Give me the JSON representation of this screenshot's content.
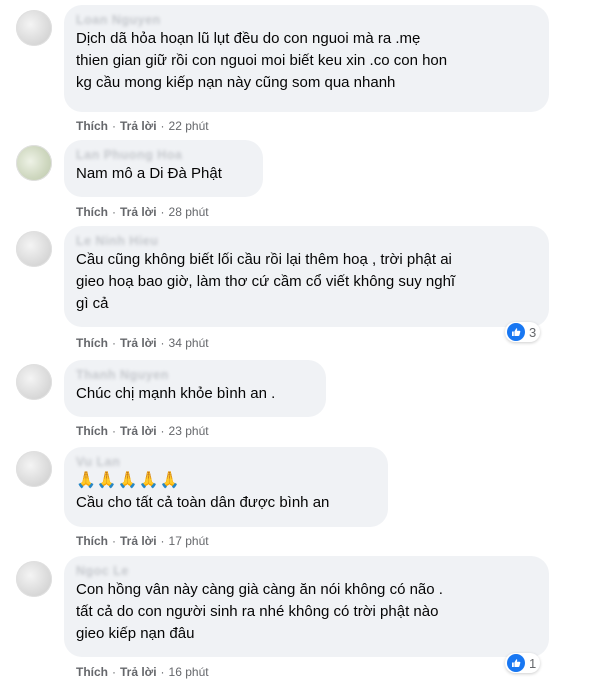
{
  "labels": {
    "like": "Thích",
    "reply": "Trả lời",
    "dot": "·"
  },
  "comments": [
    {
      "author": "Loan Nguyen",
      "text": "Dịch dã hỏa hoạn lũ lụt đều do con nguoi mà ra .mẹ\nthien gian giữ rồi con nguoi moi biết keu xin .co con hon\nkg cầu mong kiếp nạn này cũng som qua nhanh",
      "time": "22 phút"
    },
    {
      "author": "Lan Phuong Hoa",
      "text": "Nam mô a Di Đà Phật",
      "time": "28 phút"
    },
    {
      "author": "Le Ninh Hieu",
      "text": "Cầu cũng không biết lối cầu rồi lại thêm hoạ , trời phật ai\ngieo hoạ bao giờ, làm thơ cứ cầm cổ viết không suy nghĩ\ngì cả",
      "time": "34 phút",
      "reactions": {
        "icon": "like-icon",
        "count": "3"
      }
    },
    {
      "author": "Thanh Nguyen",
      "text": "Chúc chị mạnh khỏe bình an .",
      "time": "23 phút"
    },
    {
      "author": "Vu Lan",
      "emoji": "🙏🙏🙏🙏🙏",
      "text": "Cầu cho tất cả toàn dân được bình an",
      "time": "17 phút"
    },
    {
      "author": "Ngoc Le",
      "text": "Con hồng vân này càng già càng ăn nói không có não .\ntất cả do con người sinh ra nhé không có trời phật nào\ngieo kiếp nạn đâu",
      "time": "16 phút",
      "reactions": {
        "icon": "like-icon",
        "count": "1"
      }
    }
  ]
}
